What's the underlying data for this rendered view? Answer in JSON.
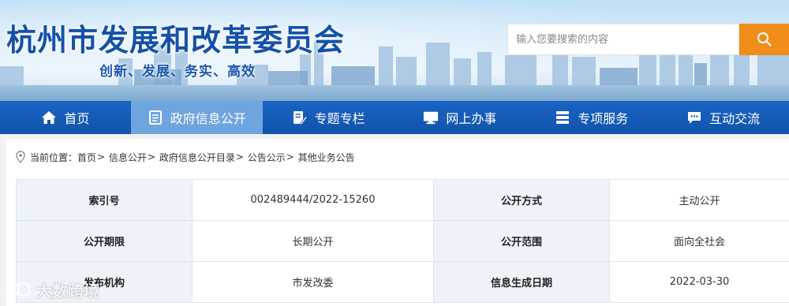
{
  "header": {
    "site_title": "杭州市发展和改革委员会",
    "slogan": "创新、发展、务实、高效",
    "search": {
      "placeholder": "输入您要搜索的内容"
    }
  },
  "nav": {
    "items": [
      {
        "label": "首页",
        "icon": "home-icon"
      },
      {
        "label": "政府信息公开",
        "icon": "document-icon",
        "active": true
      },
      {
        "label": "专题专栏",
        "icon": "edit-note-icon"
      },
      {
        "label": "网上办事",
        "icon": "monitor-icon"
      },
      {
        "label": "专项服务",
        "icon": "list-service-icon"
      },
      {
        "label": "互动交流",
        "icon": "chat-icon"
      }
    ]
  },
  "breadcrumb": {
    "prefix": "当前位置：",
    "items": [
      "首页",
      "信息公开",
      "政府信息公开目录",
      "公告公示",
      "其他业务公告"
    ],
    "separator": ">"
  },
  "info_table": {
    "rows": [
      [
        {
          "k": "索引号",
          "v": "002489444/2022-15260"
        },
        {
          "k": "公开方式",
          "v": "主动公开"
        }
      ],
      [
        {
          "k": "公开期限",
          "v": "长期公开"
        },
        {
          "k": "公开范围",
          "v": "面向全社会"
        }
      ],
      [
        {
          "k": "发布机构",
          "v": "市发改委"
        },
        {
          "k": "信息生成日期",
          "v": "2022-03-30"
        }
      ]
    ]
  },
  "watermark": {
    "text": "大数跨境"
  },
  "colors": {
    "nav_bg": "#1153ab",
    "nav_active": "#6fa5df",
    "search_button": "#f18d1a",
    "title": "#1551a8",
    "table_key_bg": "#eef3fa"
  }
}
